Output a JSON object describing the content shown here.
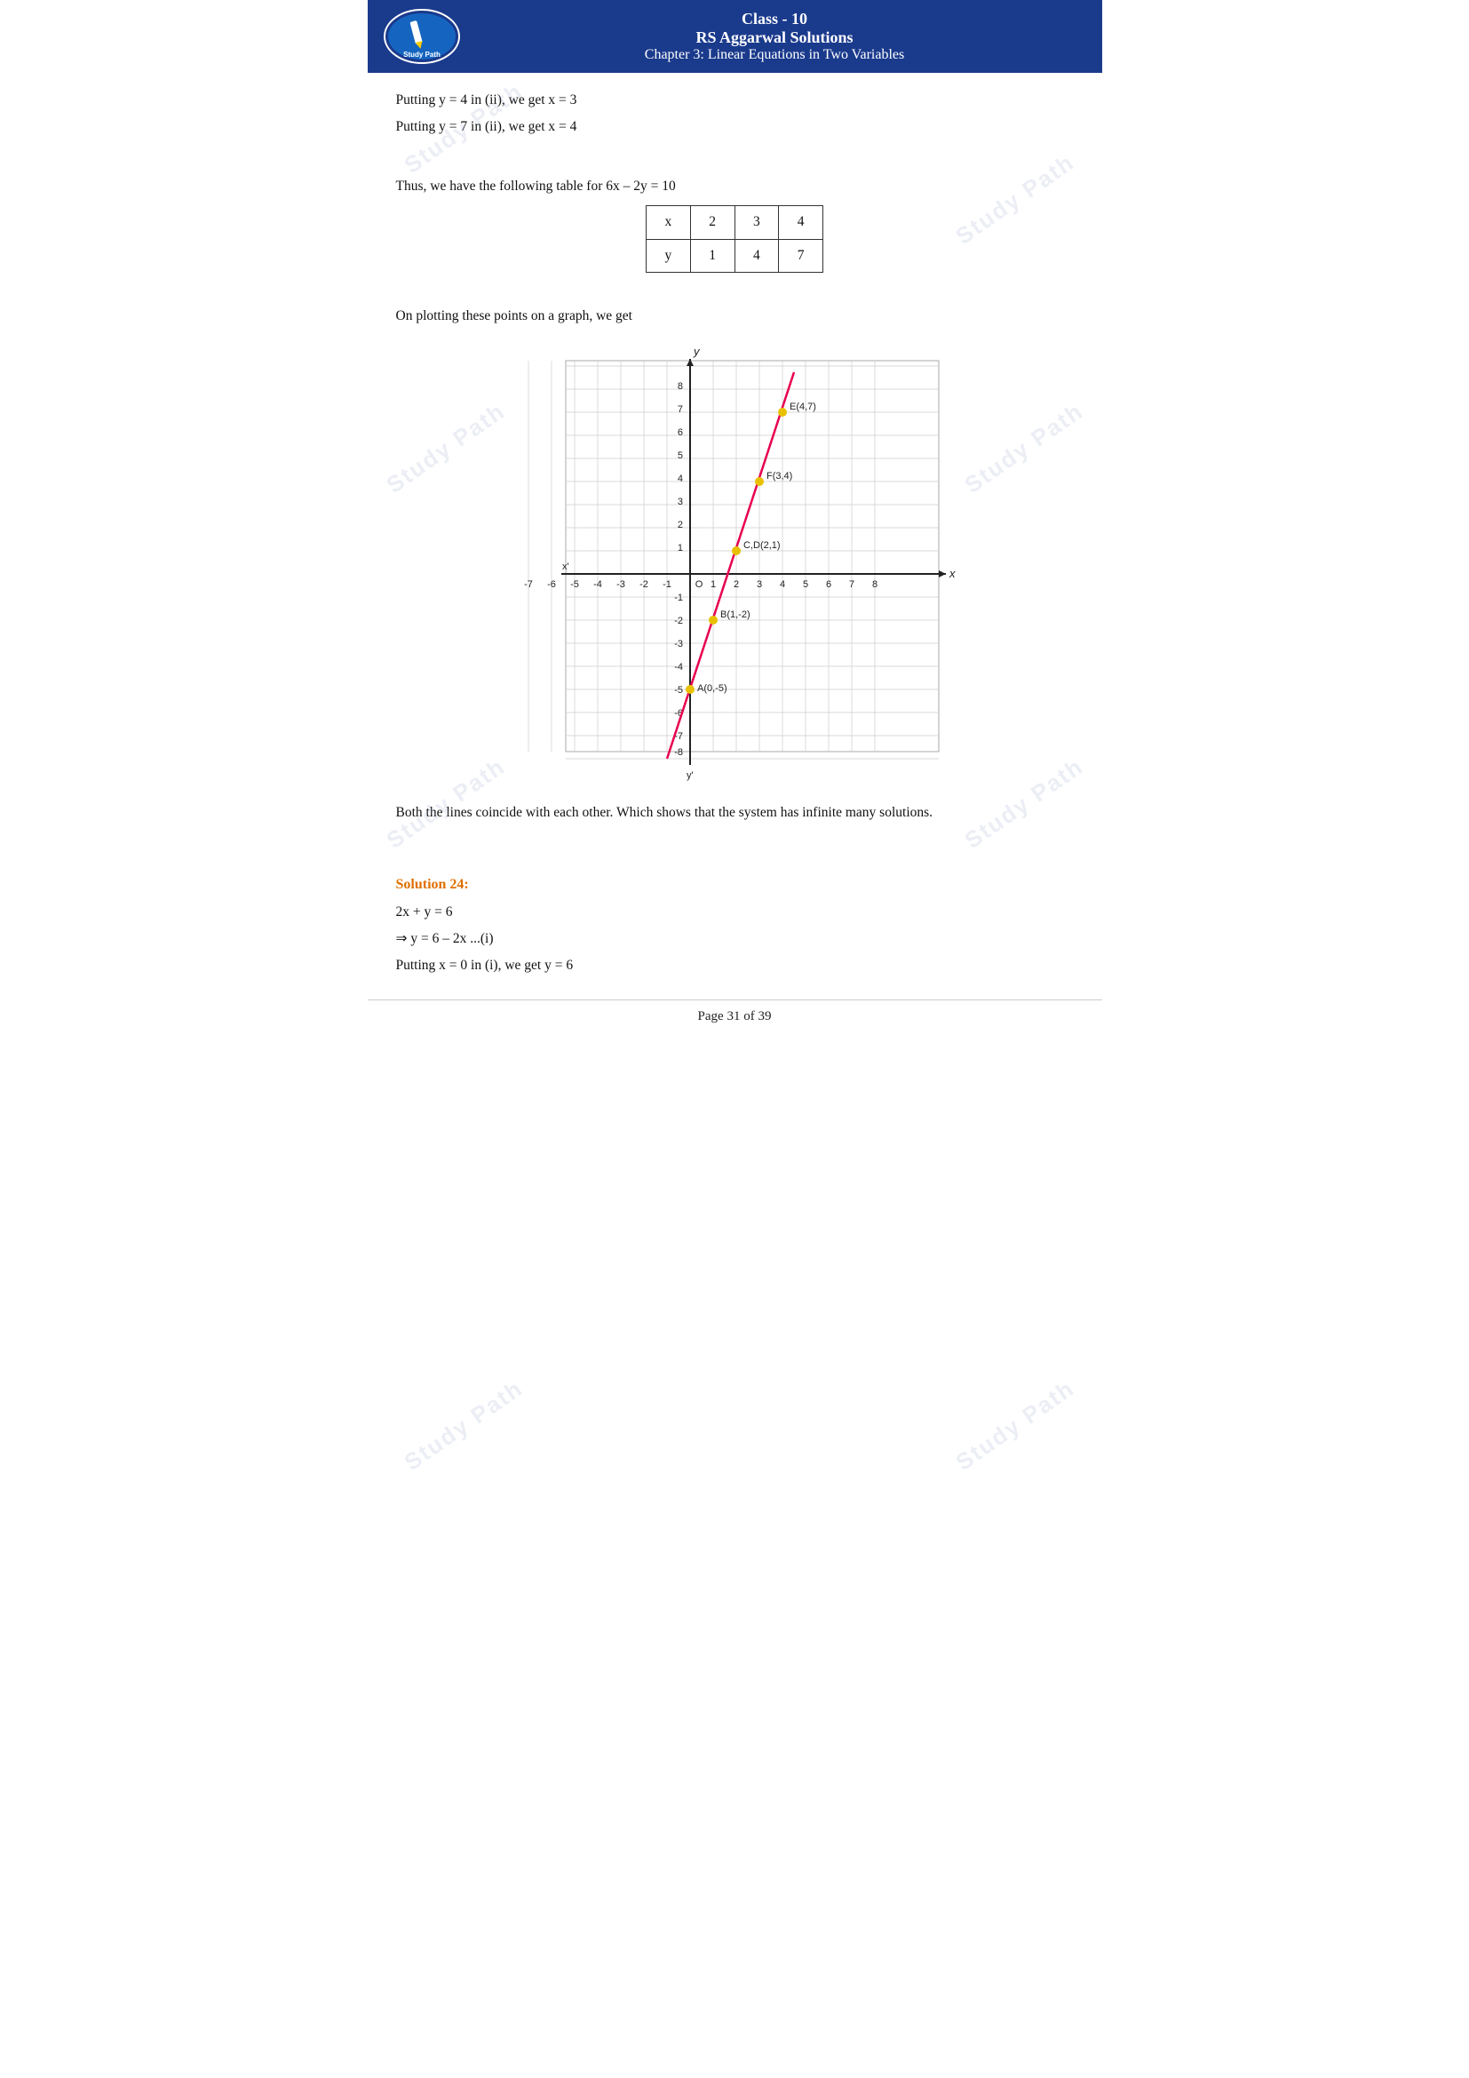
{
  "header": {
    "line1": "Class - 10",
    "line2": "RS Aggarwal Solutions",
    "line3": "Chapter 3: Linear Equations in Two Variables",
    "logo_text": "Study Path"
  },
  "content": {
    "line1": "Putting y = 4 in (ii), we get x = 3",
    "line2": "Putting y = 7 in (ii), we get x = 4",
    "table_intro": "Thus, we have the following table for 6x – 2y = 10",
    "table": {
      "headers": [
        "x",
        "2",
        "3",
        "4"
      ],
      "row2": [
        "y",
        "1",
        "4",
        "7"
      ]
    },
    "graph_intro": "On plotting these points on a graph, we get",
    "conclusion": "Both the lines coincide with each other. Which shows that the system has infinite many solutions.",
    "solution24_label": "Solution 24:",
    "sol24_line1": "2x + y = 6",
    "sol24_line2": "⇒ y = 6 – 2x        ...(i)",
    "sol24_line3": "Putting x = 0 in (i), we get y = 6"
  },
  "footer": {
    "text": "Page 31 of 39"
  },
  "graph": {
    "x_min": -7,
    "x_max": 8,
    "y_min": -8,
    "y_max": 8,
    "points": [
      {
        "label": "A(0,-5)",
        "x": 0,
        "y": -5,
        "color": "#e8c000"
      },
      {
        "label": "B(1,-2)",
        "x": 1,
        "y": -2,
        "color": "#e8c000"
      },
      {
        "label": "C,D(2,1)",
        "x": 2,
        "y": 1,
        "color": "#e8c000"
      },
      {
        "label": "F(3,4)",
        "x": 3,
        "y": 4,
        "color": "#e8c000"
      },
      {
        "label": "E(4,7)",
        "x": 4,
        "y": 7,
        "color": "#e8c000"
      }
    ],
    "line_color": "#e8004e",
    "axis_color": "#222",
    "grid_color": "#ccc"
  }
}
